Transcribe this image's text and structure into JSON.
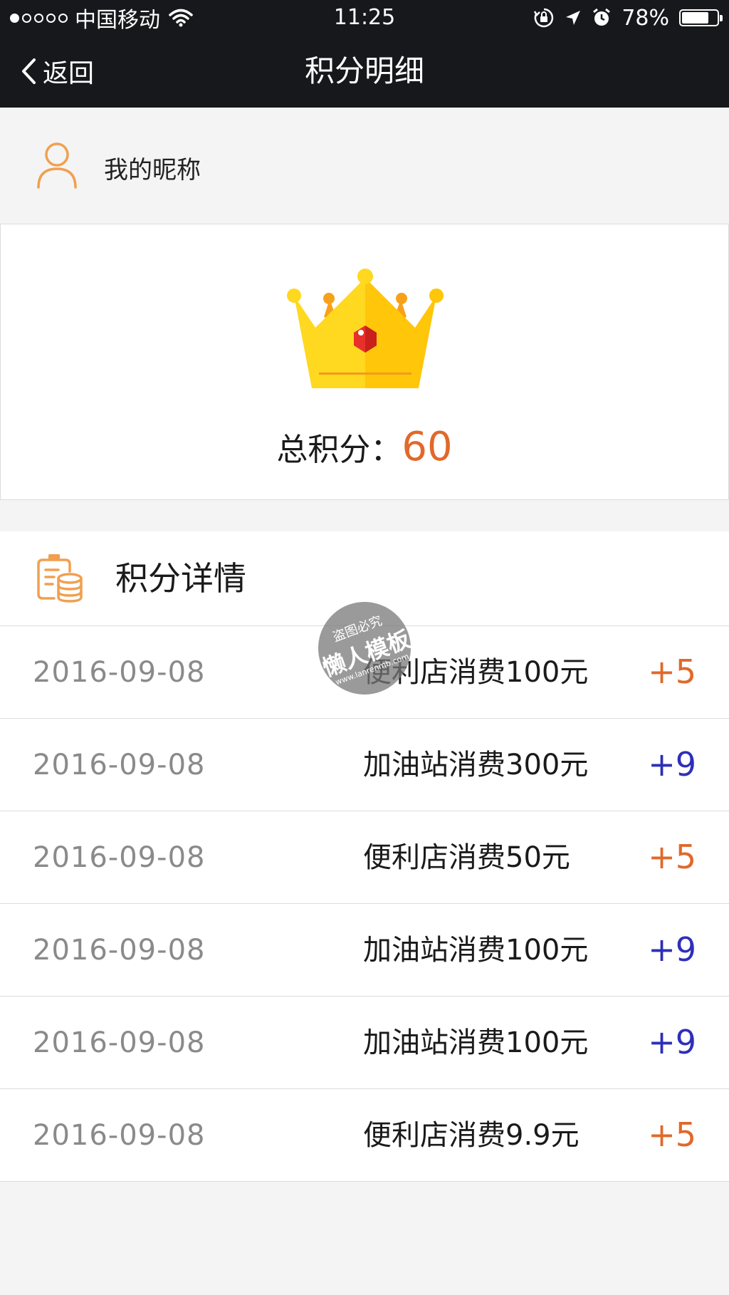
{
  "status_bar": {
    "carrier": "中国移动",
    "time": "11:25",
    "battery": "78%",
    "battery_level": 0.78
  },
  "nav": {
    "back_label": "返回",
    "title": "积分明细"
  },
  "user": {
    "nickname": "我的昵称"
  },
  "points": {
    "label": "总积分：",
    "value": "60"
  },
  "details": {
    "title": "积分详情",
    "rows": [
      {
        "date": "2016-09-08",
        "desc": "便利店消费100元",
        "points": "+5",
        "color": "#e0692a"
      },
      {
        "date": "2016-09-08",
        "desc": "加油站消费300元",
        "points": "+9",
        "color": "#2e2fb8"
      },
      {
        "date": "2016-09-08",
        "desc": "便利店消费50元",
        "points": "+5",
        "color": "#e0692a"
      },
      {
        "date": "2016-09-08",
        "desc": "加油站消费100元",
        "points": "+9",
        "color": "#2e2fb8"
      },
      {
        "date": "2016-09-08",
        "desc": "加油站消费100元",
        "points": "+9",
        "color": "#2e2fb8"
      },
      {
        "date": "2016-09-08",
        "desc": "便利店消费9.9元",
        "points": "+5",
        "color": "#e0692a"
      }
    ]
  },
  "watermark": {
    "line1": "盗图必究",
    "line2": "懒人模板",
    "line3": "www.lanrenmb.com"
  },
  "colors": {
    "accent": "#e0692a",
    "blue_points": "#2e2fb8",
    "nav_bg": "#17181c",
    "icon_orange": "#f0a050"
  },
  "icons": [
    "back-chevron-icon",
    "wifi-icon",
    "lock-rotation-icon",
    "location-arrow-icon",
    "alarm-icon",
    "battery-icon",
    "user-icon",
    "crown-icon",
    "coins-icon"
  ]
}
